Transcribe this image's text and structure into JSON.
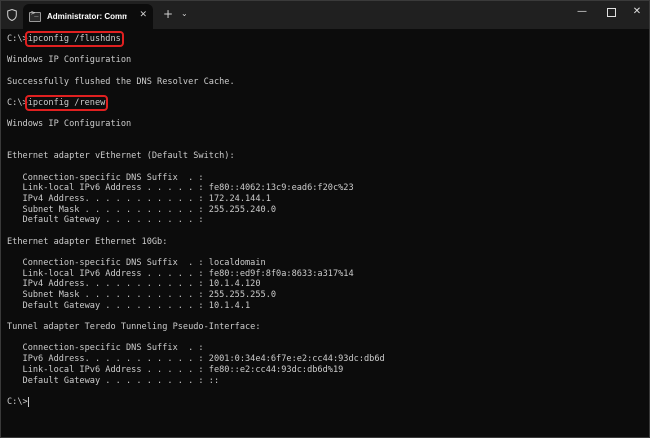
{
  "tab": {
    "title": "Administrator: Command Pro",
    "close_glyph": "✕"
  },
  "titlebar": {
    "new_tab_glyph": "+",
    "dropdown_glyph": "⌄",
    "minimize_glyph": "—",
    "close_glyph": "✕"
  },
  "terminal": {
    "lines": [
      {
        "text": "C:\\>",
        "cmd": "ipconfig /flushdns",
        "highlight": true
      },
      {
        "text": ""
      },
      {
        "text": "Windows IP Configuration"
      },
      {
        "text": ""
      },
      {
        "text": "Successfully flushed the DNS Resolver Cache."
      },
      {
        "text": ""
      },
      {
        "text": "C:\\>",
        "cmd": "ipconfig /renew",
        "highlight": true
      },
      {
        "text": ""
      },
      {
        "text": "Windows IP Configuration"
      },
      {
        "text": ""
      },
      {
        "text": ""
      },
      {
        "text": "Ethernet adapter vEthernet (Default Switch):"
      },
      {
        "text": ""
      },
      {
        "text": "   Connection-specific DNS Suffix  . :"
      },
      {
        "text": "   Link-local IPv6 Address . . . . . : fe80::4062:13c9:ead6:f20c%23"
      },
      {
        "text": "   IPv4 Address. . . . . . . . . . . : 172.24.144.1"
      },
      {
        "text": "   Subnet Mask . . . . . . . . . . . : 255.255.240.0"
      },
      {
        "text": "   Default Gateway . . . . . . . . . :"
      },
      {
        "text": ""
      },
      {
        "text": "Ethernet adapter Ethernet 10Gb:"
      },
      {
        "text": ""
      },
      {
        "text": "   Connection-specific DNS Suffix  . : localdomain"
      },
      {
        "text": "   Link-local IPv6 Address . . . . . : fe80::ed9f:8f0a:8633:a317%14"
      },
      {
        "text": "   IPv4 Address. . . . . . . . . . . : 10.1.4.120"
      },
      {
        "text": "   Subnet Mask . . . . . . . . . . . : 255.255.255.0"
      },
      {
        "text": "   Default Gateway . . . . . . . . . : 10.1.4.1"
      },
      {
        "text": ""
      },
      {
        "text": "Tunnel adapter Teredo Tunneling Pseudo-Interface:"
      },
      {
        "text": ""
      },
      {
        "text": "   Connection-specific DNS Suffix  . :"
      },
      {
        "text": "   IPv6 Address. . . . . . . . . . . : 2001:0:34e4:6f7e:e2:cc44:93dc:db6d"
      },
      {
        "text": "   Link-local IPv6 Address . . . . . : fe80::e2:cc44:93dc:db6d%19"
      },
      {
        "text": "   Default Gateway . . . . . . . . . : ::"
      },
      {
        "text": ""
      },
      {
        "text": "C:\\>",
        "prompt": true
      }
    ]
  },
  "colors": {
    "background": "#0c0c0c",
    "titlebar": "#202020",
    "text": "#cccccc",
    "highlight_box": "#e02020"
  }
}
